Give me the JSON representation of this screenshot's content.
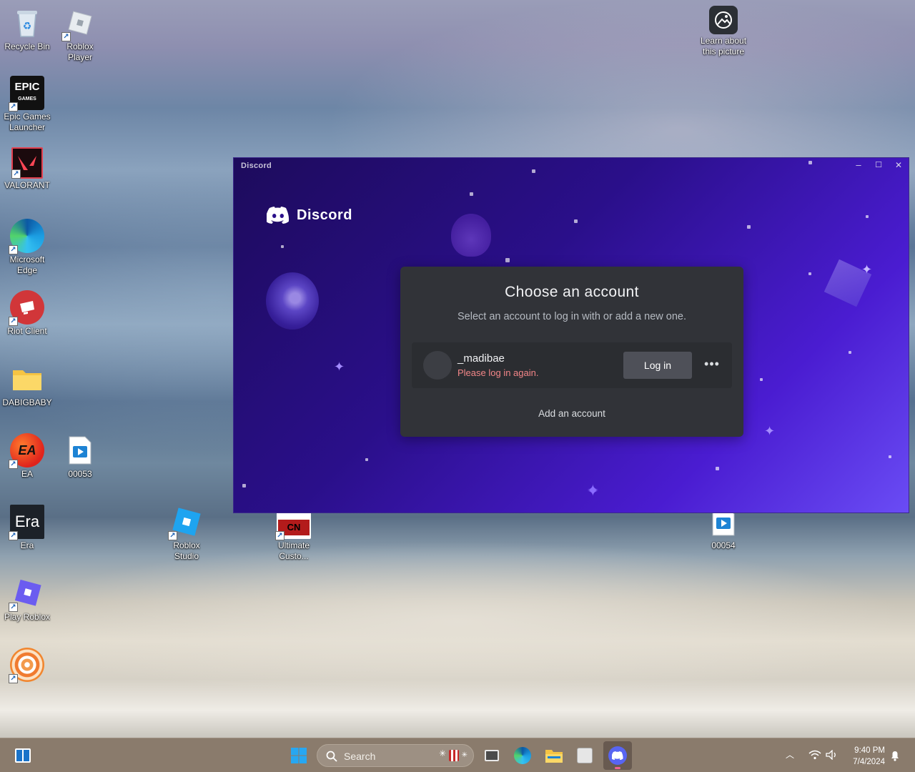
{
  "desktop": {
    "icons": [
      {
        "label": "Recycle Bin"
      },
      {
        "label": "Roblox\nPlayer"
      },
      {
        "label": "Epic Games\nLauncher"
      },
      {
        "label": "VALORANT"
      },
      {
        "label": "Microsoft\nEdge"
      },
      {
        "label": "Riot Client"
      },
      {
        "label": "DABIGBABY"
      },
      {
        "label": "EA"
      },
      {
        "label": "00053"
      },
      {
        "label": "Era"
      },
      {
        "label": "Roblox\nStudio"
      },
      {
        "label": "Ultimate\nCusto..."
      },
      {
        "label": "00054"
      },
      {
        "label": "Play Roblox"
      },
      {
        "label": "Learn about\nthis picture"
      }
    ],
    "icon_glyphs": {
      "epic_text": "EPIC",
      "epic_sub": "GAMES",
      "era_text": "Era",
      "cn_text": "CN"
    }
  },
  "discord": {
    "window_title": "Discord",
    "brand_name": "Discord",
    "window_controls": {
      "minimize": "–",
      "maximize": "☐",
      "close": "✕"
    },
    "card": {
      "title": "Choose an account",
      "subtitle": "Select an account to log in with or add a new one.",
      "account": {
        "username": "_madibae",
        "status": "Please log in again."
      },
      "login_label": "Log in",
      "more_label": "•••",
      "add_account_label": "Add an account"
    },
    "colors": {
      "accent": "#5865f2",
      "error": "#f38688"
    }
  },
  "taskbar": {
    "search_placeholder": "Search",
    "time": "9:40 PM",
    "date": "7/4/2024"
  }
}
